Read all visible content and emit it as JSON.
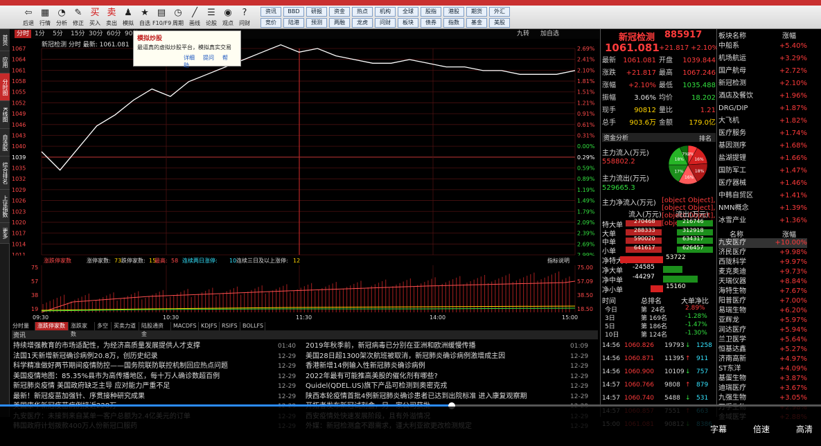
{
  "toolbar": {
    "buttons": [
      {
        "label": "后退",
        "icon": "⇦"
      },
      {
        "label": "行情",
        "icon": "▦"
      },
      {
        "label": "分析",
        "icon": "◔"
      },
      {
        "label": "修正",
        "icon": "✎"
      },
      {
        "label": "买入",
        "icon": "买"
      },
      {
        "label": "卖出",
        "icon": "卖"
      },
      {
        "label": "模拟",
        "icon": "♟"
      },
      {
        "label": "自选",
        "icon": "★"
      },
      {
        "label": "F10/F9",
        "icon": "▤"
      },
      {
        "label": "周期",
        "icon": "◷"
      },
      {
        "label": "画线",
        "icon": "╱"
      },
      {
        "label": "论股",
        "icon": "☰"
      },
      {
        "label": "观点",
        "icon": "◉"
      },
      {
        "label": "问财",
        "icon": "?"
      }
    ],
    "small_buttons": [
      "资讯",
      "竞价",
      "BBD",
      "陆港",
      "研报",
      "预测",
      "资金",
      "两融",
      "热点",
      "龙虎",
      "机构",
      "问财",
      "全球",
      "板块",
      "股指",
      "债券",
      "港股",
      "指数",
      "期货",
      "基金",
      "外汇",
      "美股"
    ]
  },
  "left_tabs": [
    "首页",
    "应用",
    "分时图",
    "K线图",
    "自选股",
    "综合排名",
    "上证指数",
    "更多"
  ],
  "chart": {
    "tabs": [
      "分时",
      "1分",
      "5分",
      "15分",
      "30分",
      "60分",
      "90分"
    ],
    "header": "新冠检测  分时  最新: 1061.081",
    "right_controls": [
      "九转",
      "加自选"
    ],
    "xlabels": [
      "09:30",
      "10:30",
      "11:30",
      "14:00",
      "15:00"
    ],
    "left_axis": [
      "1067",
      "1064",
      "1061",
      "1058",
      "1055",
      "1052",
      "1049",
      "1046",
      "1043",
      "1040",
      "1039",
      "1035",
      "1032",
      "1029",
      "1026",
      "1023",
      "1020",
      "1017",
      "1014",
      "1011"
    ],
    "right_axis": [
      "2.69%",
      "2.41%",
      "2.10%",
      "1.81%",
      "1.51%",
      "1.21%",
      "0.91%",
      "0.61%",
      "0.31%",
      "0.00%",
      "0.29%",
      "0.59%",
      "0.89%",
      "1.19%",
      "1.49%",
      "1.79%",
      "2.09%",
      "2.39%",
      "2.69%",
      "2.99%"
    ],
    "indicator_header": {
      "title": "涨跌停家数",
      "up_label": "涨停家数:",
      "up": "73",
      "down_label": "跌停家数:",
      "down": "15",
      "limit_label": "最高:",
      "limit": "58",
      "two_label": "连续两日涨停:",
      "two": "10",
      "three_label": "连续三日及以上涨停:",
      "three": "12",
      "help": "指标说明"
    },
    "ind_left_axis": [
      "75",
      "57",
      "38",
      "19"
    ],
    "ind_right_axis": [
      "75.00",
      "57.09",
      "38.50",
      "18.50"
    ],
    "subtabs": [
      "分时量",
      "涨跌停家数",
      "涨跌家数",
      "多空",
      "买卖力道",
      "陆股通资金",
      "MACDFS",
      "KDJFS",
      "RSIFS",
      "BOLLFS"
    ],
    "chart_data": {
      "type": "line",
      "title": "新冠检测",
      "series": [
        {
          "values": [
            1039,
            1034,
            1040,
            1046,
            1049,
            1053,
            1056,
            1054,
            1058,
            1060,
            1062,
            1064,
            1066,
            1068,
            1066,
            1067,
            1065,
            1064,
            1063,
            1063,
            1064,
            1063,
            1062,
            1062,
            1061,
            1061,
            1060,
            1060,
            1060,
            1061
          ]
        }
      ],
      "ylim": [
        1011,
        1067
      ]
    }
  },
  "popup": {
    "title": "模拟炒股",
    "text": "最逼真的虚拟炒股平台，模拟真实交易",
    "links": [
      "详细",
      "提问",
      "帮助"
    ]
  },
  "quote": {
    "name": "新冠检测",
    "code": "885917",
    "price": "1061.081",
    "change": "+21.817",
    "pct": "+2.10%",
    "rows": [
      {
        "l1": "最新",
        "v1": "1061.081",
        "l2": "开盘",
        "v2": "1039.844"
      },
      {
        "l1": "涨跌",
        "v1": "+21.817",
        "l2": "最高",
        "v2": "1067.246"
      },
      {
        "l1": "涨幅",
        "v1": "+2.10%",
        "l2": "最低",
        "v2": "1035.488"
      },
      {
        "l1": "振幅",
        "v1": "3.06%",
        "l2": "均价",
        "v2": "18.202"
      },
      {
        "l1": "现手",
        "v1": "90812",
        "l2": "量比",
        "v2": "1.21"
      },
      {
        "l1": "总手",
        "v1": "903.6万",
        "l2": "金额",
        "v2": "179.0亿"
      }
    ],
    "fund_title": "资金分析",
    "fund_rank": "排名",
    "inflow_label": "主力流入(万元)",
    "inflow": "558802.2",
    "outflow_label": "主力流出(万元)",
    "outflow": "529665.3",
    "net_label": "主力净流入(万元)",
    "net": [
      {
        "label": "净特大单",
        "value": "53722",
        "pos": true,
        "fill": 0.62
      },
      {
        "label": "净大单",
        "value": "-24585",
        "pos": false,
        "fill": 0.28
      },
      {
        "label": "净中单",
        "value": "-44297",
        "pos": false,
        "fill": 0.5
      },
      {
        "label": "净小单",
        "value": "15160",
        "pos": true,
        "fill": 0.18
      }
    ],
    "pie": [
      {
        "label": "8%",
        "value": 8,
        "color": "#ff3b3b"
      },
      {
        "label": "16%",
        "value": 16,
        "color": "#d42020"
      },
      {
        "label": "18%",
        "value": 18,
        "color": "#b01818"
      },
      {
        "label": "16%",
        "value": 16,
        "color": "#ff5a5a"
      },
      {
        "label": "17%",
        "value": 17,
        "color": "#1c8f1c"
      },
      {
        "label": "18%",
        "value": 18,
        "color": "#26b526"
      },
      {
        "label": "7%",
        "value": 7,
        "color": "#0f6e0f"
      }
    ],
    "flow_header": [
      "流入(万元)",
      "流出(万元)"
    ],
    "flow": [
      {
        "label": "特大单",
        "in": "270468",
        "out": "216746"
      },
      {
        "label": "大单",
        "in": "288333",
        "out": "312918"
      },
      {
        "label": "中单",
        "in": "590020",
        "out": "634317"
      },
      {
        "label": "小单",
        "in": "641617",
        "out": "626457"
      }
    ],
    "rank_header": [
      "时间",
      "总排名",
      "大单净比"
    ],
    "rank": [
      {
        "t": "今日",
        "r": "第  24名",
        "v": "2.89%"
      },
      {
        "t": "3日",
        "r": "第 169名",
        "v": "-1.28%"
      },
      {
        "t": "5日",
        "r": "第 186名",
        "v": "-1.47%"
      },
      {
        "t": "10日",
        "r": "第 124名",
        "v": "-1.30%"
      }
    ],
    "ticks": [
      {
        "t": "14:56",
        "p": "1060.826",
        "v": "19793",
        "d": "1258"
      },
      {
        "t": "14:56",
        "p": "1060.871",
        "v": "11395",
        "d": "911"
      },
      {
        "t": "14:56",
        "p": "1060.900",
        "v": "10109",
        "d": "757"
      },
      {
        "t": "14:57",
        "p": "1060.766",
        "v": "9808",
        "d": "879"
      },
      {
        "t": "14:57",
        "p": "1060.740",
        "v": "5488",
        "d": "531"
      },
      {
        "t": "14:57",
        "p": "1060.857",
        "v": "7551",
        "d": "663"
      },
      {
        "t": "15:00",
        "p": "1061.081",
        "v": "90812",
        "d": "8386"
      }
    ]
  },
  "sectors": {
    "header": [
      "板块名称",
      "涨幅"
    ],
    "items": [
      {
        "n": "中船系",
        "v": "+5.40%"
      },
      {
        "n": "机场航运",
        "v": "+3.29%"
      },
      {
        "n": "国产航母",
        "v": "+2.72%"
      },
      {
        "n": "新冠检测",
        "v": "+2.10%"
      },
      {
        "n": "酒店及餐饮",
        "v": "+1.96%"
      },
      {
        "n": "DRG/DIP",
        "v": "+1.87%"
      },
      {
        "n": "大飞机",
        "v": "+1.82%"
      },
      {
        "n": "医疗服务",
        "v": "+1.74%"
      },
      {
        "n": "基因测序",
        "v": "+1.68%"
      },
      {
        "n": "盐湖提锂",
        "v": "+1.66%"
      },
      {
        "n": "国防军工",
        "v": "+1.47%"
      },
      {
        "n": "医疗器械",
        "v": "+1.46%"
      },
      {
        "n": "中韩自贸区",
        "v": "+1.41%"
      },
      {
        "n": "NMN概念",
        "v": "+1.39%"
      },
      {
        "n": "冰雪产业",
        "v": "+1.36%"
      }
    ],
    "stock_header": [
      "名称",
      "涨幅"
    ],
    "stocks": [
      {
        "n": "九安医疗",
        "v": "+10.00%"
      },
      {
        "n": "济民医疗",
        "v": "+9.98%"
      },
      {
        "n": "西陇科学",
        "v": "+9.97%"
      },
      {
        "n": "麦克奥迪",
        "v": "+9.73%"
      },
      {
        "n": "天瑞仪器",
        "v": "+8.84%"
      },
      {
        "n": "海特生物",
        "v": "+7.67%"
      },
      {
        "n": "阳普医疗",
        "v": "+7.00%"
      },
      {
        "n": "易瑞生物",
        "v": "+6.20%"
      },
      {
        "n": "亚辉龙",
        "v": "+5.97%"
      },
      {
        "n": "润达医疗",
        "v": "+5.94%"
      },
      {
        "n": "兰卫医学",
        "v": "+5.64%"
      },
      {
        "n": "恒基达鑫",
        "v": "+5.27%"
      },
      {
        "n": "济南高新",
        "v": "+4.97%"
      },
      {
        "n": "ST东洋",
        "v": "+4.09%"
      },
      {
        "n": "基蛋生物",
        "v": "+3.87%"
      },
      {
        "n": "迪瑞医疗",
        "v": "+3.67%"
      },
      {
        "n": "九强生物",
        "v": "+3.05%"
      },
      {
        "n": "万孚生物",
        "v": "+2.98%"
      },
      {
        "n": "金域医学",
        "v": "+2.88%"
      }
    ]
  },
  "news": {
    "title": "资讯",
    "left": [
      {
        "t": "持续增强教育的市场适配性，为经济高质量发展提供人才支撑",
        "d": "01:40"
      },
      {
        "t": "法国1天新增新冠确诊病例20.8万，创历史纪录",
        "d": "12-29"
      },
      {
        "t": "科学精准做好两节期间疫情防控——国务院联防联控机制回应热点问题",
        "d": "12-29"
      },
      {
        "t": "美国疫情地图：85.35%县市为高传播地区，每十万人确诊数超百例",
        "d": "12-29"
      },
      {
        "t": "新冠肺炎疫情 美国政府缺乏主导 应对能力严重不足",
        "d": "12-29"
      },
      {
        "t": "最新！新冠疫苗加强针、序贯接种研究成果",
        "d": "12-29"
      },
      {
        "t": "美国康华新冠疫苗病例接近228万",
        "d": "12-29"
      },
      {
        "t": "九安医疗：未接到来自某单一客户总额为2.4亿美元的订单",
        "d": "12-29"
      },
      {
        "t": "韩国政府计划拨款400万人份新冠口服药",
        "d": "12-29"
      }
    ],
    "right": [
      {
        "t": "2019年秋季前，新冠病毒已分别在亚洲和欧洲缓慢传播",
        "d": "01:09"
      },
      {
        "t": "美国28日超1300架次航班被取消，新冠肺炎确诊病例激增成主因",
        "d": "12-29"
      },
      {
        "t": "香港新增14例输入性新冠肺炎确诊病例",
        "d": "12-29"
      },
      {
        "t": "2022年最有可能推高美股的催化剂有哪些?",
        "d": "12-29"
      },
      {
        "t": "Quidel(QDEL.US)旗下产品可检测到奥密克戎",
        "d": "12-29"
      },
      {
        "t": "陕西本轮疫情首批4例新冠肺炎确诊患者已达到出院标准 进入康复观察期",
        "d": "12-29"
      },
      {
        "t": "开拓者发布新冠试剂盒，另一家公司获批",
        "d": "12-29"
      },
      {
        "t": "西安疫情处快速发展阶段，且有外溢情况",
        "d": "12-29"
      },
      {
        "t": "外媒：新冠检测盒不跟需求，谨大利亚欲更改检测规定",
        "d": "12-29"
      }
    ]
  },
  "bottom": {
    "subtitle": "字幕",
    "speed": "倍速",
    "quality": "高清",
    "progress": 0.55
  }
}
